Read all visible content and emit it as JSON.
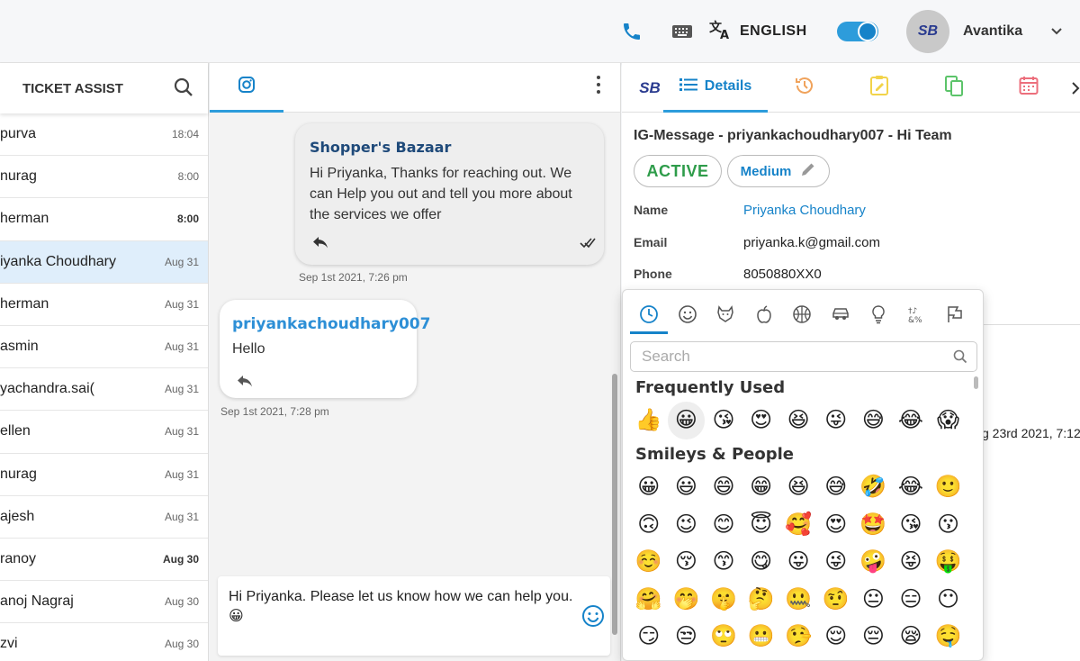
{
  "header": {
    "language": "ENGLISH",
    "avatar_initials": "SB",
    "user_name": "Avantika",
    "toggle_on": true
  },
  "left_panel": {
    "title": "TICKET ASSIST",
    "conversations": [
      {
        "name": "purva",
        "time": "18:04",
        "bold": false,
        "active": false
      },
      {
        "name": "nurag",
        "time": "8:00",
        "bold": false,
        "active": false
      },
      {
        "name": "herman",
        "time": "8:00",
        "bold": true,
        "active": false
      },
      {
        "name": "iyanka Choudhary",
        "time": "Aug 31",
        "bold": false,
        "active": true
      },
      {
        "name": "herman",
        "time": "Aug 31",
        "bold": false,
        "active": false
      },
      {
        "name": "asmin",
        "time": "Aug 31",
        "bold": false,
        "active": false
      },
      {
        "name": "yachandra.sai(",
        "time": "Aug 31",
        "bold": false,
        "active": false
      },
      {
        "name": "ellen",
        "time": "Aug 31",
        "bold": false,
        "active": false
      },
      {
        "name": "nurag",
        "time": "Aug 31",
        "bold": false,
        "active": false
      },
      {
        "name": "ajesh",
        "time": "Aug 31",
        "bold": false,
        "active": false
      },
      {
        "name": "ranoy",
        "time": "Aug 30",
        "bold": true,
        "active": false
      },
      {
        "name": "anoj Nagraj",
        "time": "Aug 30",
        "bold": false,
        "active": false
      },
      {
        "name": "zvi",
        "time": "Aug 30",
        "bold": false,
        "active": false
      }
    ]
  },
  "chat": {
    "messages": [
      {
        "sender": "Shopper's Bazaar",
        "text": "Hi Priyanka, Thanks for reaching out. We can Help you out and tell you more about the services we offer",
        "timestamp": "Sep 1st 2021, 7:26 pm"
      },
      {
        "sender": "priyankachoudhary007",
        "text": "Hello",
        "timestamp": "Sep 1st 2021, 7:28 pm"
      }
    ],
    "composer_text": "Hi Priyanka. Please let us know how we can help you. 😀"
  },
  "details": {
    "tab_label": "Details",
    "logo": "SB",
    "title": "IG-Message - priyankachoudhary007 - Hi Team",
    "status": "ACTIVE",
    "priority": "Medium",
    "fields": [
      {
        "label": "Name",
        "value": "Priyanka Choudhary",
        "link": true
      },
      {
        "label": "Email",
        "value": "priyanka.k@gmail.com",
        "link": false
      },
      {
        "label": "Phone",
        "value": "8050880XX0",
        "link": false
      }
    ],
    "partial_text": "g 23rd 2021, 7:12"
  },
  "emoji_picker": {
    "categories": [
      "clock-icon",
      "smiley-icon",
      "animal-icon",
      "food-icon",
      "activity-icon",
      "travel-icon",
      "objects-icon",
      "symbols-icon",
      "flags-icon"
    ],
    "search_placeholder": "Search",
    "frequently_used_heading": "Frequently Used",
    "frequently_used": [
      "👍",
      "😀",
      "😘",
      "😍",
      "😆",
      "😜",
      "😅",
      "😂",
      "😱"
    ],
    "smileys_heading": "Smileys & People",
    "smileys": [
      "😀",
      "😃",
      "😄",
      "😁",
      "😆",
      "😅",
      "🤣",
      "😂",
      "🙂",
      "🙃",
      "😉",
      "😊",
      "😇",
      "🥰",
      "😍",
      "🤩",
      "😘",
      "😗",
      "☺️",
      "😚",
      "😙",
      "😋",
      "😛",
      "😜",
      "🤪",
      "😝",
      "🤑",
      "🤗",
      "🤭",
      "🤫",
      "🤔",
      "🤐",
      "🤨",
      "😐",
      "😑",
      "😶",
      "😏",
      "😒",
      "🙄",
      "😬",
      "🤥",
      "😌",
      "😔",
      "😪",
      "🤤"
    ]
  }
}
